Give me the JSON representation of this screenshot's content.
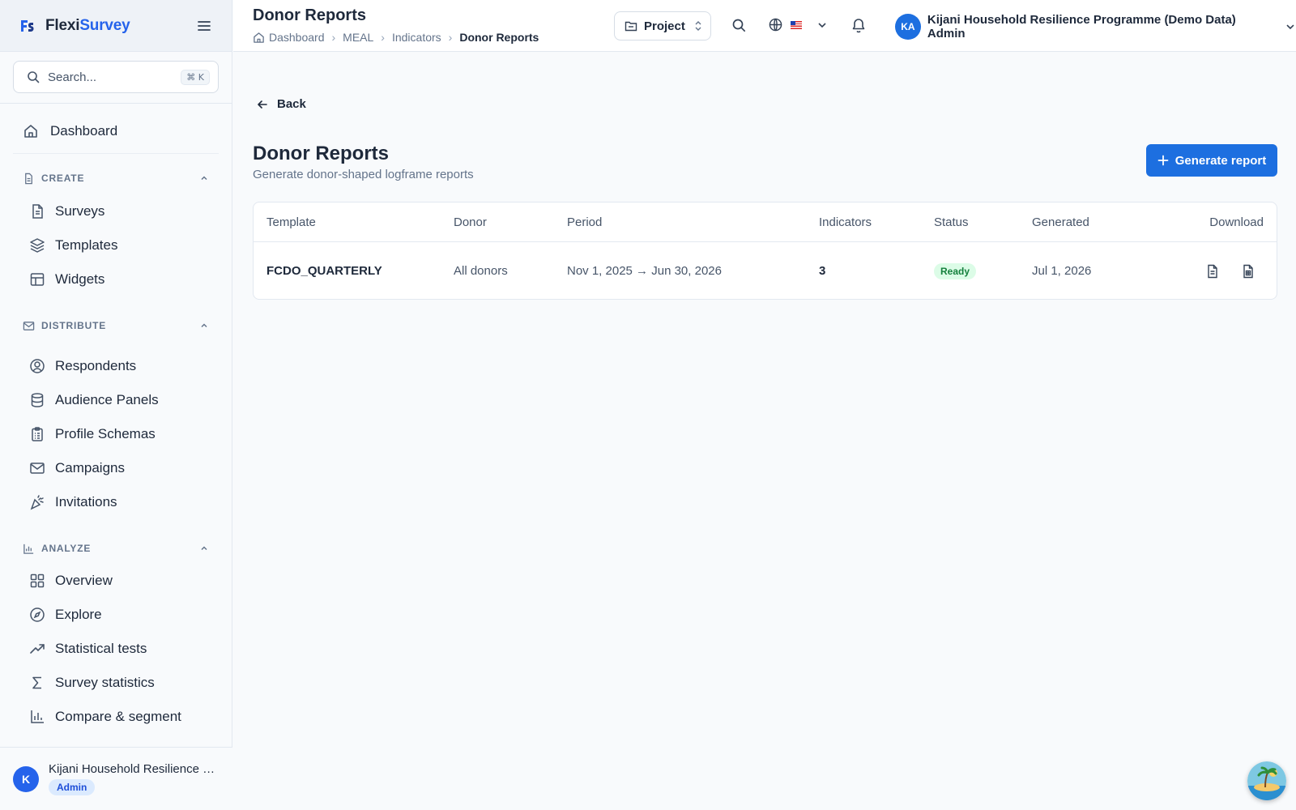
{
  "brand": {
    "name_a": "Flexi",
    "name_b": "Survey"
  },
  "sidebar": {
    "search": {
      "placeholder": "Search...",
      "shortcut": "⌘ K"
    },
    "dashboard": "Dashboard",
    "sections": [
      {
        "title": "CREATE",
        "items": [
          "Surveys",
          "Templates",
          "Widgets"
        ]
      },
      {
        "title": "DISTRIBUTE",
        "items": [
          "Respondents",
          "Audience Panels",
          "Profile Schemas",
          "Campaigns",
          "Invitations"
        ]
      },
      {
        "title": "ANALYZE",
        "items": [
          "Overview",
          "Explore",
          "Statistical tests",
          "Survey statistics",
          "Compare & segment"
        ]
      }
    ],
    "footer": {
      "initial": "K",
      "name": "Kijani Household Resilience Pr...",
      "role": "Admin"
    }
  },
  "header": {
    "title": "Donor Reports",
    "breadcrumbs": [
      "Dashboard",
      "MEAL",
      "Indicators",
      "Donor Reports"
    ],
    "project_label": "Project",
    "user": {
      "initials": "KA",
      "name": "Kijani Household Resilience Programme (Demo Data) Admin"
    }
  },
  "page": {
    "back_label": "Back",
    "title": "Donor Reports",
    "subtitle": "Generate donor-shaped logframe reports",
    "generate_label": "Generate report"
  },
  "table": {
    "columns": [
      "Template",
      "Donor",
      "Period",
      "Indicators",
      "Status",
      "Generated",
      "Download"
    ],
    "rows": [
      {
        "template": "FCDO_QUARTERLY",
        "donor": "All donors",
        "period": "Nov 1, 2025 → Jun 30, 2026",
        "indicators": "3",
        "status": "Ready",
        "generated": "Jul 1, 2026"
      }
    ]
  },
  "colors": {
    "accent": "#1d6fe0",
    "ready_bg": "#dcfce7",
    "ready_fg": "#15803d"
  }
}
